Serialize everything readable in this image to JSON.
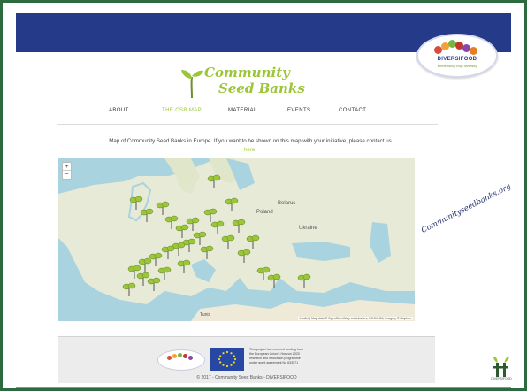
{
  "header": {
    "partner_logo_name": "DIVERSIFOOD",
    "partner_logo_tagline": "embedding crop diversity",
    "brand_colors": {
      "navy": "#263a8a",
      "green": "#9cc63a",
      "frame": "#2d6b3f"
    }
  },
  "site": {
    "logo_line1": "Community",
    "logo_line2": "Seed Banks"
  },
  "nav": {
    "items": [
      {
        "label": "ABOUT",
        "active": false
      },
      {
        "label": "THE CSB MAP",
        "active": true
      },
      {
        "label": "MATERIAL",
        "active": false
      },
      {
        "label": "EVENTS",
        "active": false
      },
      {
        "label": "CONTACT",
        "active": false
      }
    ]
  },
  "intro": {
    "text": "Map of Community Seed Banks in Europe. If you want to be shown on this map with your initiative, please contact us",
    "link": "here."
  },
  "map": {
    "zoom_in": "+",
    "zoom_out": "−",
    "labels": {
      "belarus": "Belarus",
      "poland": "Poland",
      "ukraine": "Ukraine",
      "tunis": "Tunis"
    },
    "attribution": "Leaflet | Map data © OpenStreetMap contributors, CC-BY-SA, Imagery © Mapbox",
    "marker_icon": "sprout-marker-icon"
  },
  "side_url": "Communityseedbanks.org",
  "footer": {
    "eu_text": "This project has received funding from the European Union's Horizon 2020 research and innovation programme under grant agreement No 633571",
    "copyright": "© 2017 - Community Seed Banks - DIVERSIFOOD"
  },
  "corner_logo": {
    "caption": "DIVERSIFOOD"
  }
}
